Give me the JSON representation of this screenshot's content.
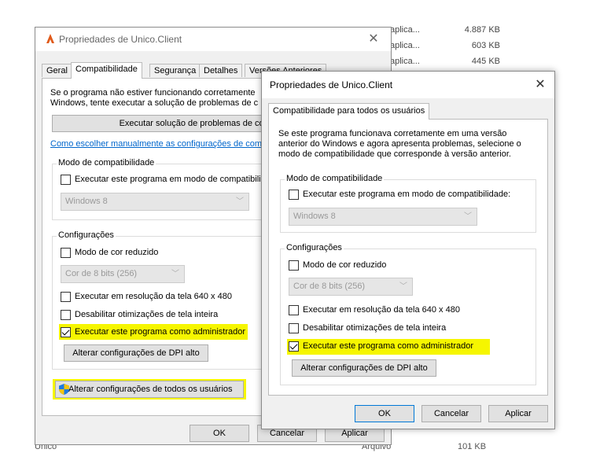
{
  "background": {
    "files": [
      {
        "type": "aplica...",
        "size": "4.887 KB"
      },
      {
        "type": "aplica...",
        "size": "603 KB"
      },
      {
        "type": "aplica...",
        "size": "445 KB"
      }
    ],
    "bottom_row": {
      "name": "Unico",
      "type": "Arquivo",
      "size": "101 KB"
    }
  },
  "dialog1": {
    "title": "Propriedades de Unico.Client",
    "tabs": [
      "Geral",
      "Compatibilidade",
      "Segurança",
      "Detalhes",
      "Versões Anteriores"
    ],
    "intro_line1": "Se o programa não estiver funcionando corretamente",
    "intro_line2": "Windows, tente executar a solução de problemas de c",
    "run_troubleshooter": "Executar solução de problemas de compatibilidade",
    "manual_link": "Como escolher manualmente as configurações de com",
    "compat_group": "Modo de compatibilidade",
    "compat_checkbox": "Executar este programa em modo de compatibilid",
    "os_select": "Windows 8",
    "settings_group": "Configurações",
    "reduced_color": "Modo de cor reduzido",
    "color_select": "Cor de 8 bits (256)",
    "res_640": "Executar em resolução da tela 640 x 480",
    "disable_fullscreen": "Desabilitar otimizações de tela inteira",
    "run_admin": "Executar este programa como administrador",
    "dpi_button": "Alterar configurações de DPI alto",
    "all_users_button": "Alterar configurações de todos os usuários",
    "ok": "OK",
    "cancel": "Cancelar",
    "apply": "Aplicar"
  },
  "dialog2": {
    "title": "Propriedades de Unico.Client",
    "tab": "Compatibilidade para todos os usuários",
    "intro_line1": "Se este programa funcionava corretamente em uma versão",
    "intro_line2": "anterior do Windows e agora apresenta problemas, selecione o",
    "intro_line3": "modo de compatibilidade que corresponde à versão anterior.",
    "compat_group": "Modo de compatibilidade",
    "compat_checkbox": "Executar este programa em modo de compatibilidade:",
    "os_select": "Windows 8",
    "settings_group": "Configurações",
    "reduced_color": "Modo de cor reduzido",
    "color_select": "Cor de 8 bits (256)",
    "res_640": "Executar em resolução da tela 640 x 480",
    "disable_fullscreen": "Desabilitar otimizações de tela inteira",
    "run_admin": "Executar este programa como administrador",
    "dpi_button": "Alterar configurações de DPI alto",
    "ok": "OK",
    "cancel": "Cancelar",
    "apply": "Aplicar"
  }
}
